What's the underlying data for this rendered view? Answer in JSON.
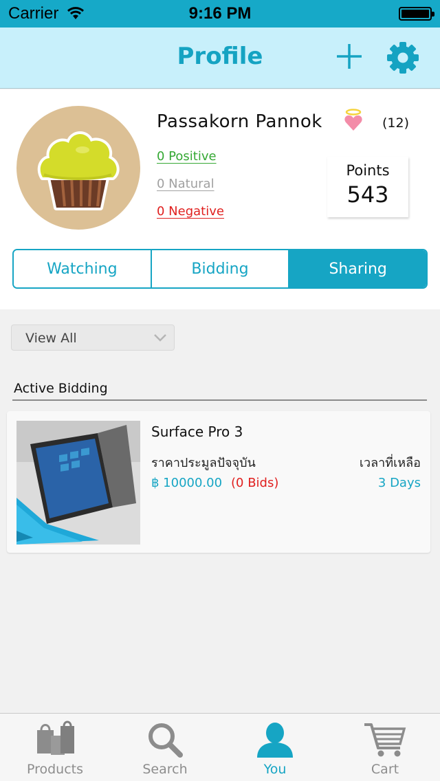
{
  "status_bar": {
    "carrier": "Carrier",
    "time": "9:16 PM",
    "battery_level": 1.0
  },
  "nav": {
    "title": "Profile",
    "add_icon": "plus-icon",
    "settings_icon": "gear-icon"
  },
  "profile": {
    "name": "Passakorn  Pannok",
    "badge_icon": "angel-heart-icon",
    "reputation_count": "(12)",
    "ratings": {
      "positive": "0  Positive",
      "natural": "0  Natural",
      "negative": "0  Negative"
    },
    "points_label": "Points",
    "points_value": "543"
  },
  "segments": {
    "items": [
      {
        "label": "Watching"
      },
      {
        "label": "Bidding"
      },
      {
        "label": "Sharing"
      }
    ],
    "active_index": 2
  },
  "filter": {
    "selected": "View  All"
  },
  "section": {
    "title": "Active Bidding"
  },
  "listing": {
    "name": "Surface  Pro  3",
    "price_label": "ราคาประมูลปัจจุบัน",
    "time_label": "เวลาที่เหลือ",
    "price": "฿  10000.00",
    "bids": "(0  Bids)",
    "time_left": "3  Days"
  },
  "tabs": [
    {
      "label": "Products",
      "icon": "shopping-bags-icon"
    },
    {
      "label": "Search",
      "icon": "search-icon"
    },
    {
      "label": "You",
      "icon": "user-icon"
    },
    {
      "label": "Cart",
      "icon": "cart-icon"
    }
  ],
  "active_tab": "You",
  "colors": {
    "accent": "#16a5c4",
    "nav_background": "#c8f0fb",
    "positive": "#34a833",
    "neutral": "#a0a0a0",
    "negative": "#e0201f"
  }
}
